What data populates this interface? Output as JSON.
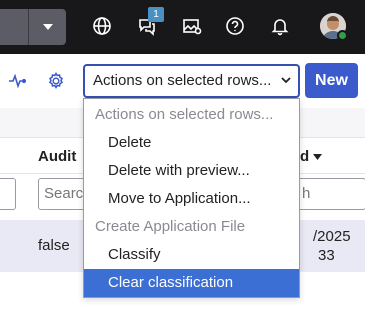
{
  "topbar": {
    "notification_count": "1",
    "icons": [
      "globe-icon",
      "chat-icon",
      "image-settings-icon",
      "help-icon",
      "bell-icon"
    ]
  },
  "toolbar": {
    "actions_select_value": "Actions on selected rows...",
    "new_label": "New"
  },
  "table": {
    "headers": {
      "audit": "Audit",
      "date_partial": "d"
    },
    "filters": {
      "audit_placeholder": "Searc",
      "date_placeholder": "h"
    },
    "rows": [
      {
        "audit": "false",
        "date_line1": "/2025",
        "date_line2": "33"
      }
    ]
  },
  "dropdown": {
    "items": [
      {
        "label": "Actions on selected rows...",
        "kind": "group"
      },
      {
        "label": "Delete",
        "kind": "option"
      },
      {
        "label": "Delete with preview...",
        "kind": "option"
      },
      {
        "label": "Move to Application...",
        "kind": "option"
      },
      {
        "label": "Create Application File",
        "kind": "group"
      },
      {
        "label": "Classify",
        "kind": "option"
      },
      {
        "label": "Clear classification",
        "kind": "option",
        "selected": true
      }
    ]
  },
  "colors": {
    "topbar": "#18181b",
    "accent": "#3b5bcc",
    "selected_row": "#e9e9f5",
    "dropdown_highlight": "#3b6fd4"
  }
}
